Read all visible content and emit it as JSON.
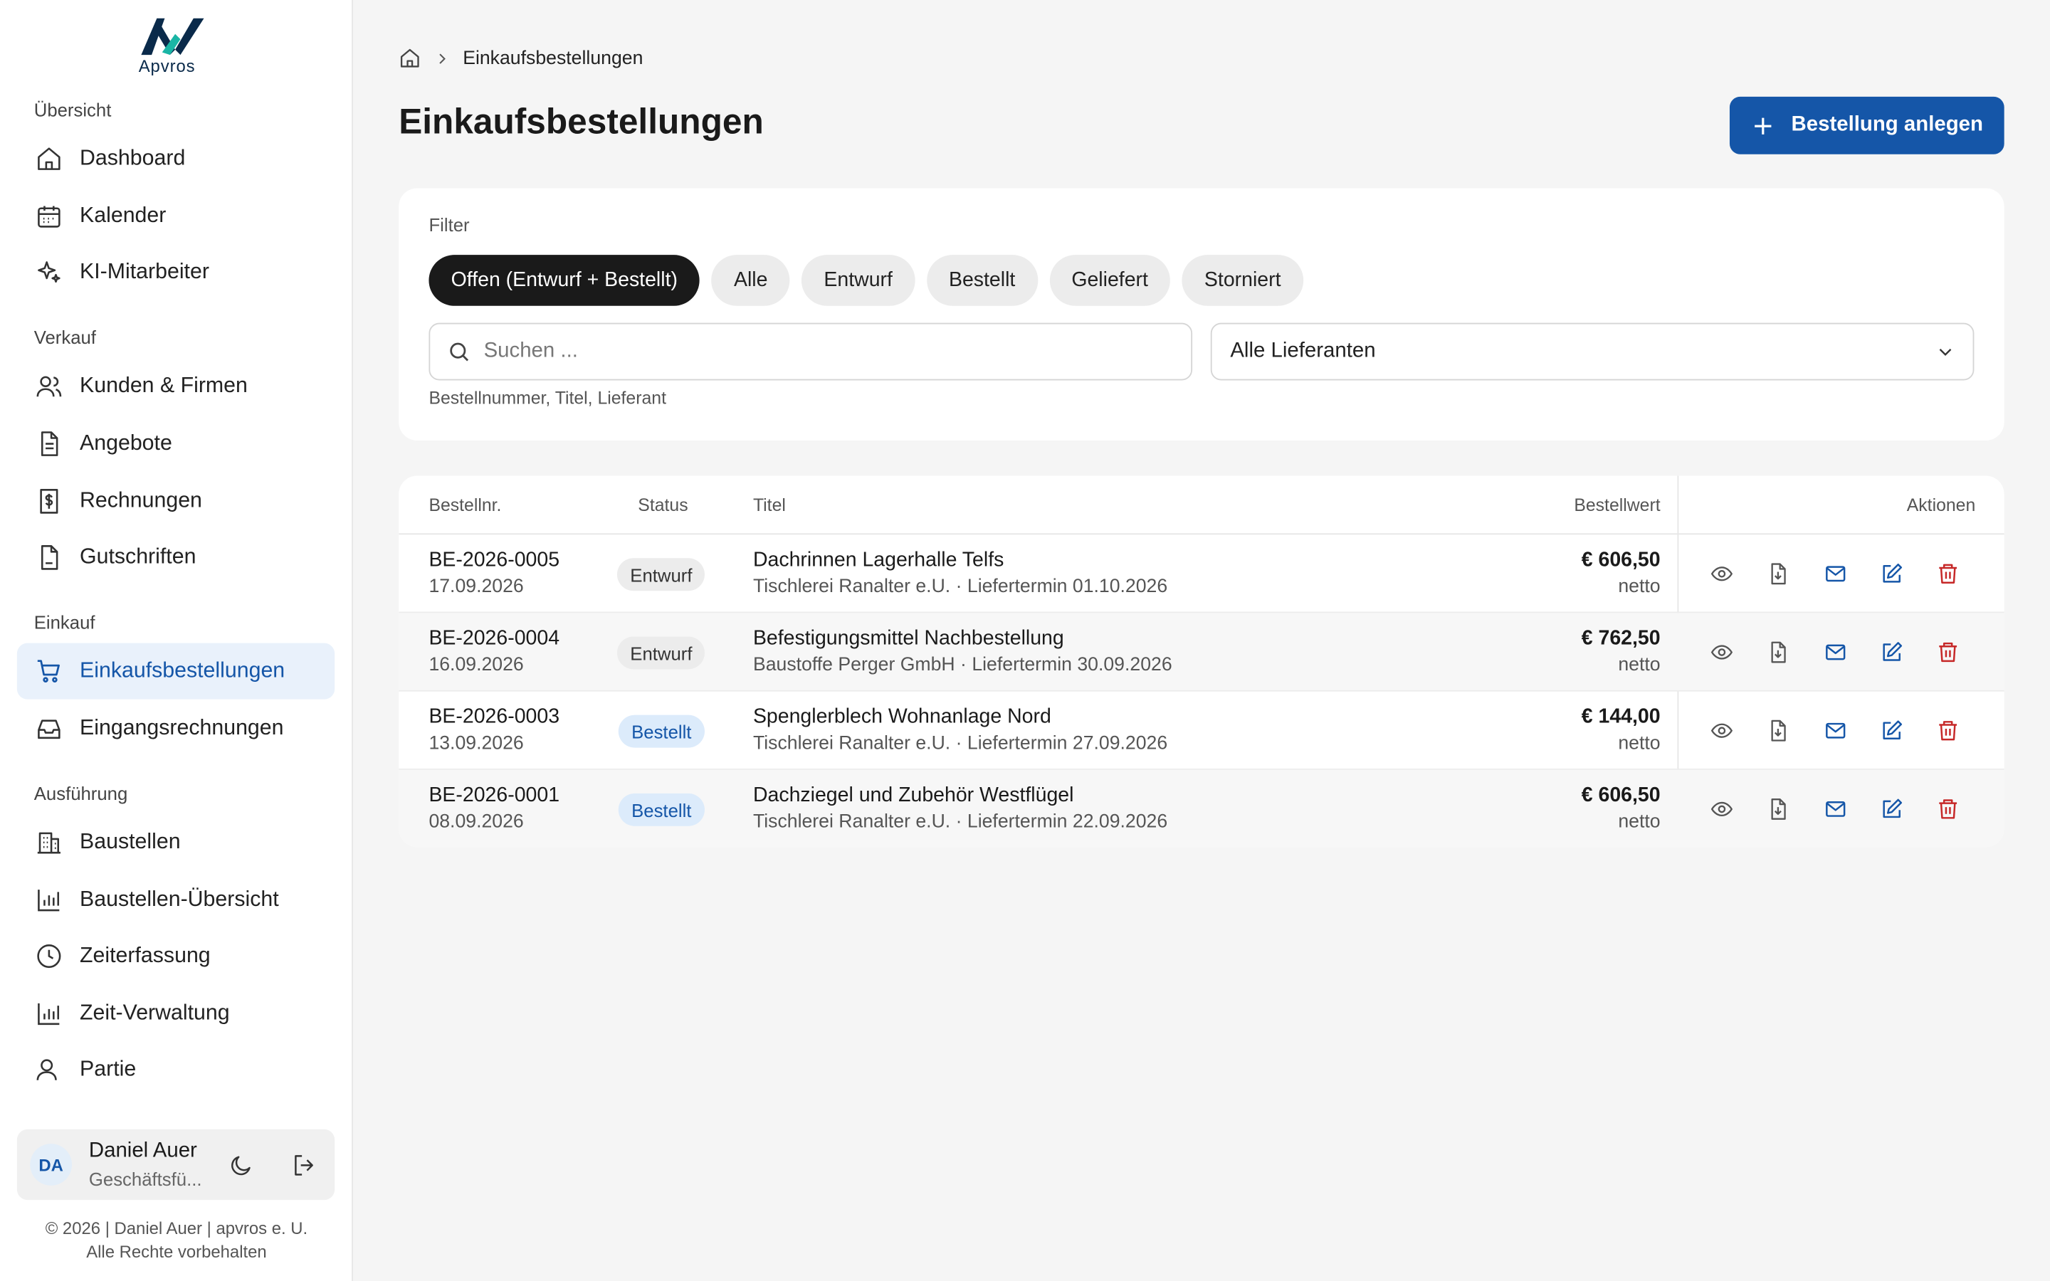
{
  "brand": {
    "name": "Apvros"
  },
  "sidebar": {
    "sections": [
      {
        "label": "Übersicht",
        "items": [
          {
            "label": "Dashboard",
            "icon": "home-icon"
          },
          {
            "label": "Kalender",
            "icon": "calendar-icon"
          },
          {
            "label": "KI-Mitarbeiter",
            "icon": "sparkles-icon"
          }
        ]
      },
      {
        "label": "Verkauf",
        "items": [
          {
            "label": "Kunden & Firmen",
            "icon": "users-icon"
          },
          {
            "label": "Angebote",
            "icon": "document-icon"
          },
          {
            "label": "Rechnungen",
            "icon": "invoice-dollar-icon"
          },
          {
            "label": "Gutschriften",
            "icon": "file-icon"
          }
        ]
      },
      {
        "label": "Einkauf",
        "items": [
          {
            "label": "Einkaufsbestellungen",
            "icon": "cart-icon",
            "active": true
          },
          {
            "label": "Eingangsrechnungen",
            "icon": "inbox-icon"
          }
        ]
      },
      {
        "label": "Ausführung",
        "items": [
          {
            "label": "Baustellen",
            "icon": "building-icon"
          },
          {
            "label": "Baustellen-Übersicht",
            "icon": "bar-chart-icon"
          },
          {
            "label": "Zeiterfassung",
            "icon": "clock-icon"
          },
          {
            "label": "Zeit-Verwaltung",
            "icon": "bar-chart-icon"
          },
          {
            "label": "Partie",
            "icon": "users-icon"
          }
        ]
      }
    ],
    "user": {
      "initials": "DA",
      "name": "Daniel Auer",
      "role": "Geschäftsfü..."
    },
    "footer": {
      "line1": "© 2026 | Daniel Auer | apvros e. U.",
      "line2": "Alle Rechte vorbehalten"
    }
  },
  "breadcrumb": {
    "current": "Einkaufsbestellungen"
  },
  "page": {
    "title": "Einkaufsbestellungen",
    "primary_button": "Bestellung anlegen"
  },
  "filter": {
    "label": "Filter",
    "chips": [
      {
        "label": "Offen (Entwurf + Bestellt)",
        "active": true
      },
      {
        "label": "Alle"
      },
      {
        "label": "Entwurf"
      },
      {
        "label": "Bestellt"
      },
      {
        "label": "Geliefert"
      },
      {
        "label": "Storniert"
      }
    ],
    "search_placeholder": "Suchen ...",
    "search_value": "",
    "supplier_select": "Alle Lieferanten",
    "hint": "Bestellnummer, Titel, Lieferant"
  },
  "table": {
    "headers": {
      "number": "Bestellnr.",
      "status": "Status",
      "title": "Titel",
      "value": "Bestellwert",
      "actions": "Aktionen"
    },
    "rows": [
      {
        "number": "BE-2026-0005",
        "date": "17.09.2026",
        "status": "Entwurf",
        "status_kind": "draft",
        "title": "Dachrinnen Lagerhalle Telfs",
        "subtitle": "Tischlerei Ranalter e.U. · Liefertermin 01.10.2026",
        "amount": "€ 606,50",
        "net": "netto"
      },
      {
        "number": "BE-2026-0004",
        "date": "16.09.2026",
        "status": "Entwurf",
        "status_kind": "draft",
        "title": "Befestigungsmittel Nachbestellung",
        "subtitle": "Baustoffe Perger GmbH · Liefertermin 30.09.2026",
        "amount": "€ 762,50",
        "net": "netto"
      },
      {
        "number": "BE-2026-0003",
        "date": "13.09.2026",
        "status": "Bestellt",
        "status_kind": "ordered",
        "title": "Spenglerblech Wohnanlage Nord",
        "subtitle": "Tischlerei Ranalter e.U. · Liefertermin 27.09.2026",
        "amount": "€ 144,00",
        "net": "netto"
      },
      {
        "number": "BE-2026-0001",
        "date": "08.09.2026",
        "status": "Bestellt",
        "status_kind": "ordered",
        "title": "Dachziegel und Zubehör Westflügel",
        "subtitle": "Tischlerei Ranalter e.U. · Liefertermin 22.09.2026",
        "amount": "€ 606,50",
        "net": "netto"
      }
    ],
    "action_icons": [
      "eye-icon",
      "download-file-icon",
      "mail-icon",
      "edit-icon",
      "trash-icon"
    ]
  },
  "colors": {
    "accent": "#1556a8",
    "danger": "#c62828",
    "active_bg": "#e9f1fb"
  }
}
